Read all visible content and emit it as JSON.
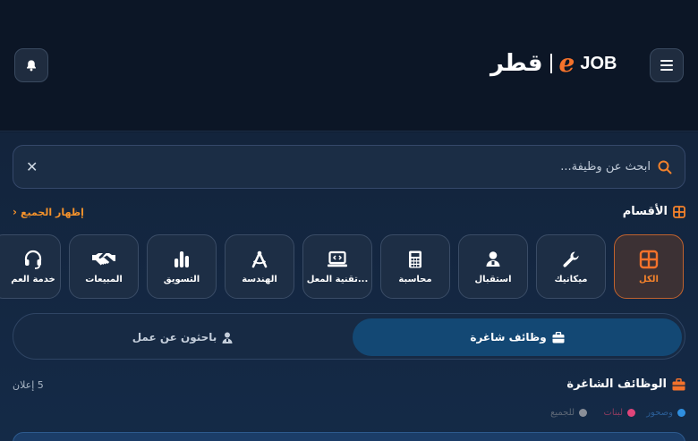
{
  "header": {
    "logo_ar": "قطر",
    "logo_e": "e",
    "logo_job": "JOB"
  },
  "search": {
    "placeholder": "ابحث عن وظيفة..."
  },
  "categories_section": {
    "title": "الأقسام",
    "show_all": "إظهار الجميع",
    "items": [
      {
        "label": "الكل",
        "icon": "grid-icon",
        "active": true
      },
      {
        "label": "ميكانيك",
        "icon": "wrench-icon"
      },
      {
        "label": "استقبال",
        "icon": "receptionist-icon"
      },
      {
        "label": "محاسبة",
        "icon": "calculator-icon"
      },
      {
        "label": "تقنية المعل...",
        "icon": "laptop-code-icon"
      },
      {
        "label": "الهندسة",
        "icon": "compass-icon"
      },
      {
        "label": "التسويق",
        "icon": "bar-chart-icon"
      },
      {
        "label": "المبيعات",
        "icon": "handshake-icon"
      },
      {
        "label": "خدمة العم",
        "icon": "headset-icon"
      }
    ]
  },
  "tabs": {
    "jobs": "وظائف شاغرة",
    "seekers": "باحثون عن عمل"
  },
  "jobs_section": {
    "title": "الوظائف الشاغرة",
    "count": "5 إعلان"
  },
  "legend": [
    {
      "label": "وصحور",
      "color": "#2f8fe0"
    },
    {
      "label": "لبنات",
      "color": "#e0457a"
    },
    {
      "label": "للجميع",
      "color": "#8a8f98"
    }
  ],
  "colors": {
    "accent": "#f4722b",
    "background": "#13243c",
    "active_tab": "#134874"
  }
}
